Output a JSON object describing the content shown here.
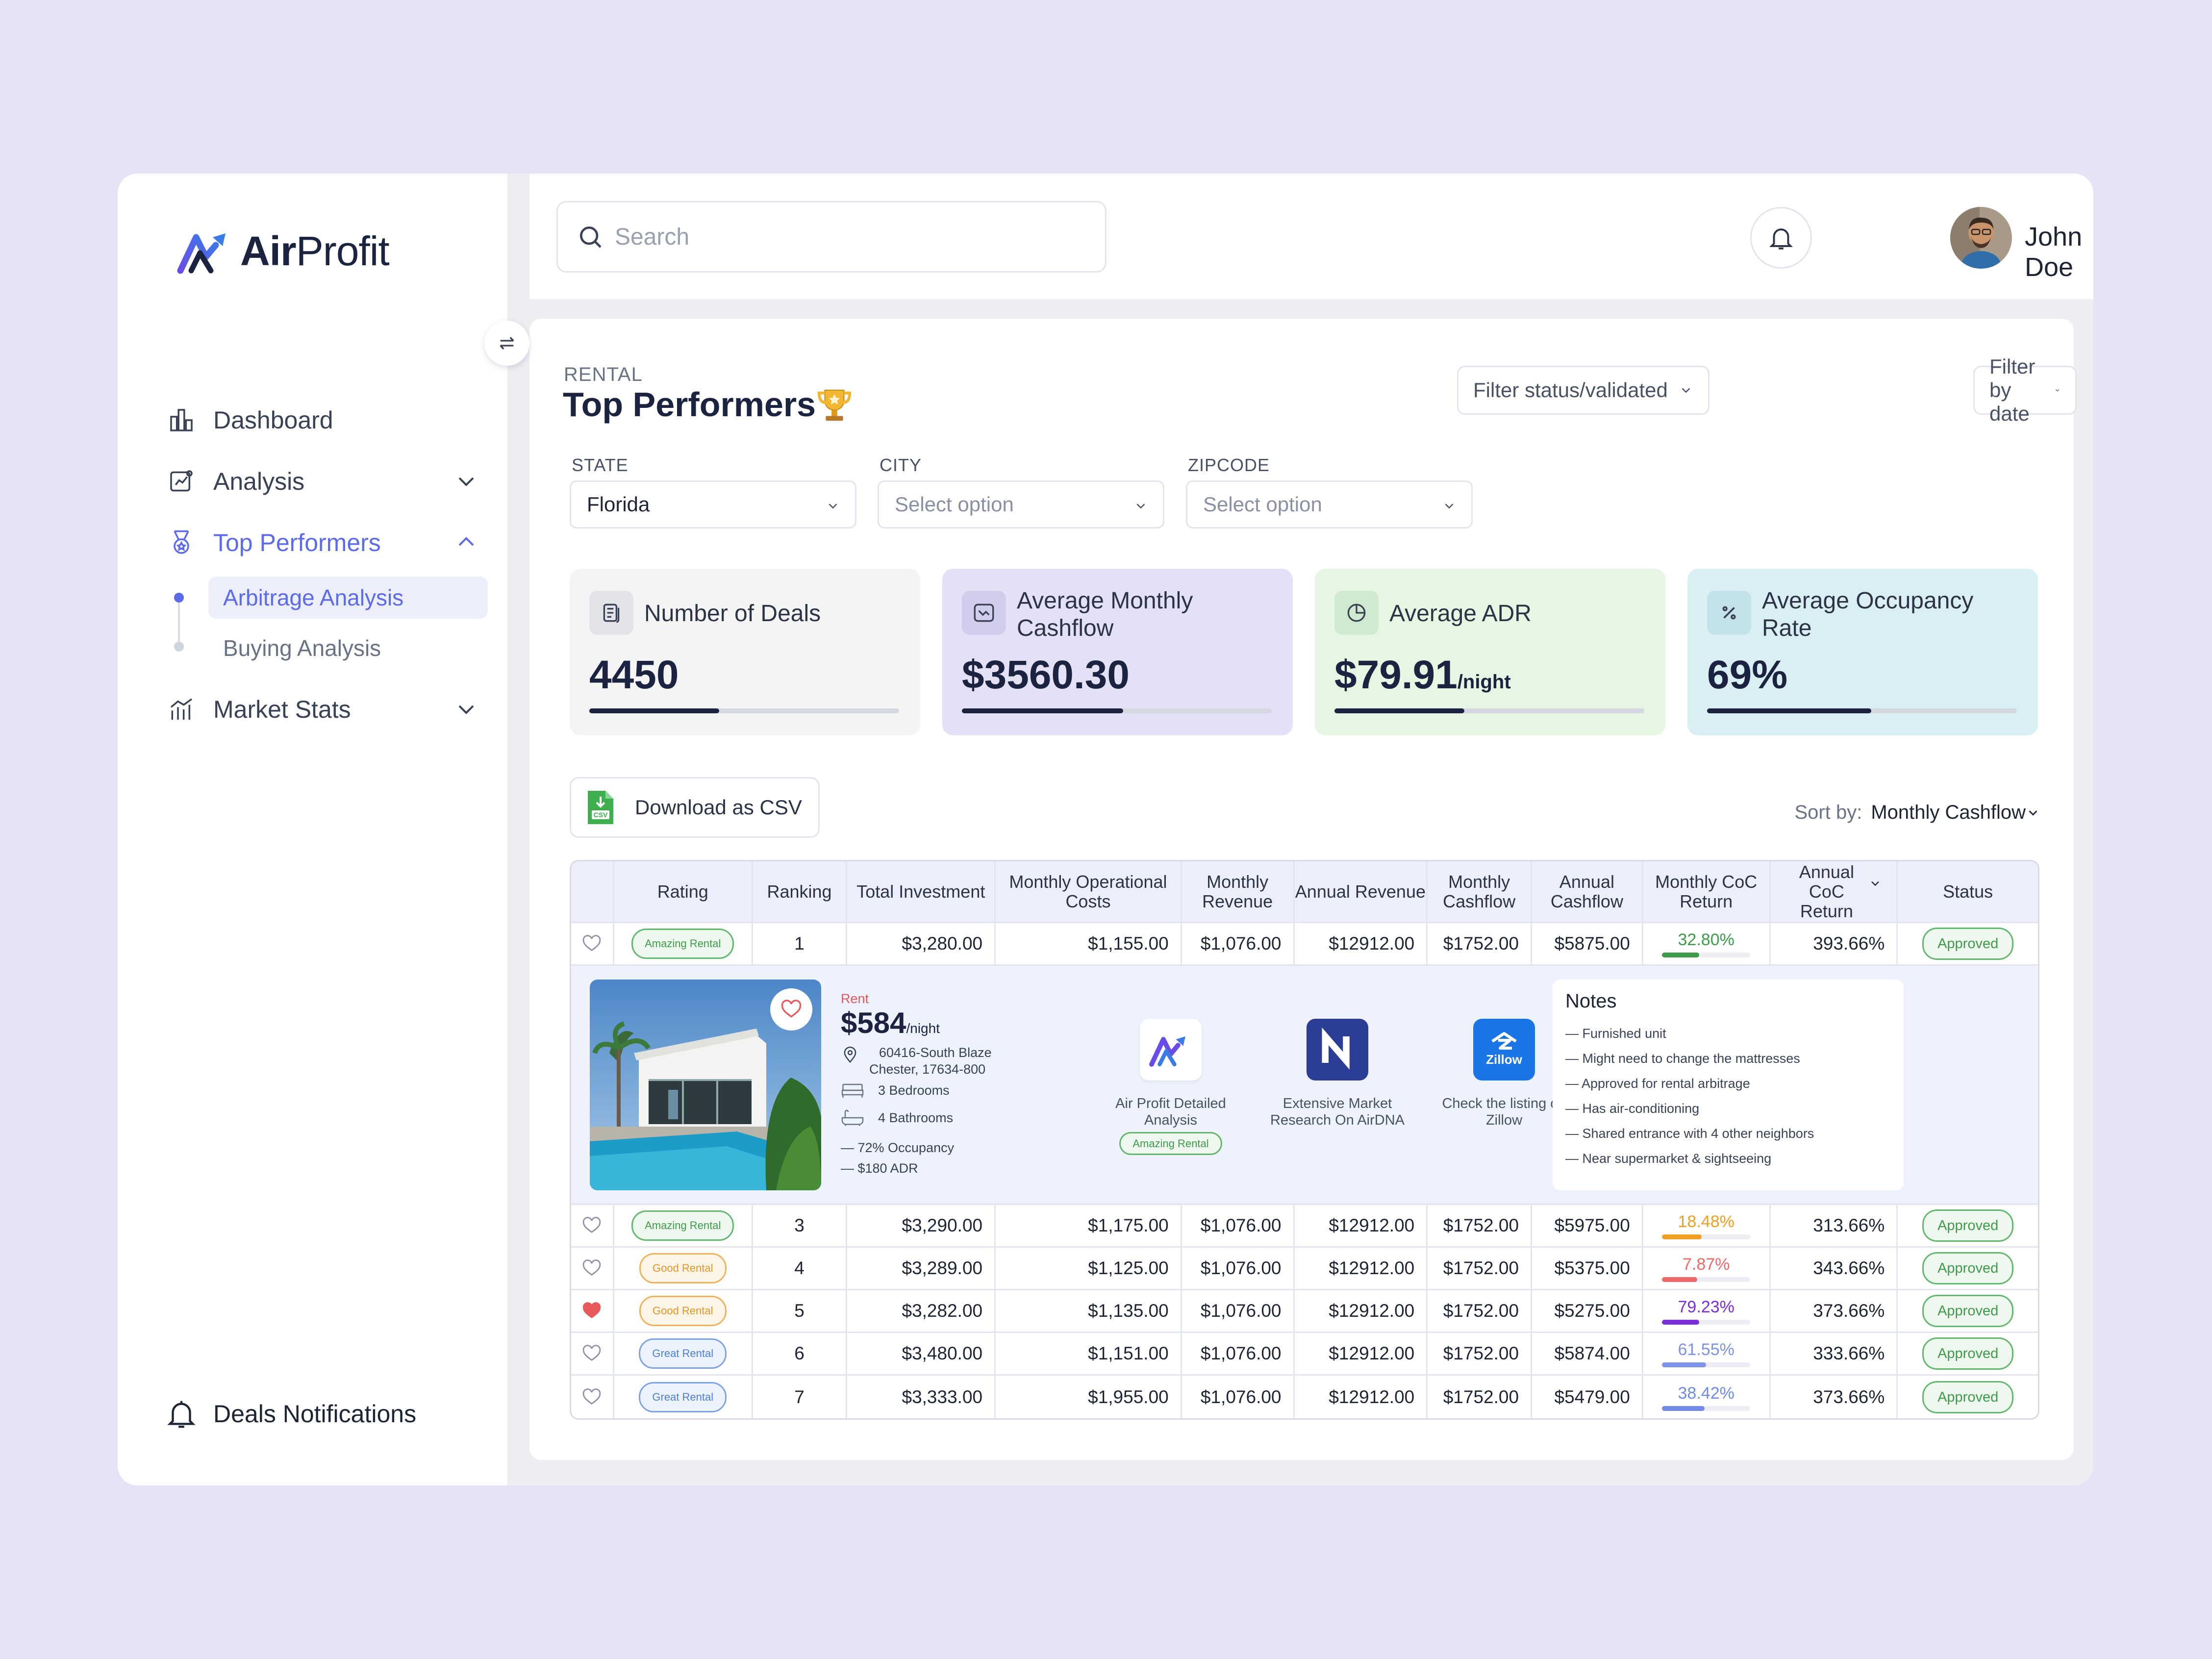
{
  "brand": {
    "name_bold": "Air",
    "name_rest": "Profit"
  },
  "sidebar": {
    "items": [
      {
        "label": "Dashboard"
      },
      {
        "label": "Analysis"
      },
      {
        "label": "Top Performers"
      },
      {
        "label": "Market Stats"
      }
    ],
    "sub_items": [
      {
        "label": "Arbitrage Analysis"
      },
      {
        "label": "Buying Analysis"
      }
    ],
    "footer": {
      "label": "Deals Notifications"
    }
  },
  "header": {
    "search_placeholder": "Search",
    "user_name": "John Doe"
  },
  "page": {
    "kicker": "RENTAL",
    "title": "Top Performers",
    "filter_status": "Filter status/validated",
    "filter_date": "Filter by date",
    "state_label": "STATE",
    "state_value": "Florida",
    "city_label": "CITY",
    "city_value": "Select option",
    "zip_label": "ZIPCODE",
    "zip_value": "Select option"
  },
  "cards": [
    {
      "title": "Number of Deals",
      "value": "4450",
      "unit": "",
      "progress": 0.42,
      "color": "#f4f4f5"
    },
    {
      "title": "Average Monthly Cashflow",
      "value": "$3560.30",
      "unit": "",
      "progress": 0.52,
      "color": "#e4e1f6"
    },
    {
      "title": "Average ADR",
      "value": "$79.91",
      "unit": "/night",
      "progress": 0.42,
      "color": "#e6f6e3"
    },
    {
      "title": "Average Occupancy Rate",
      "value": "69%",
      "unit": "",
      "progress": 0.53,
      "color": "#d9eff4"
    }
  ],
  "toolbar": {
    "csv_label": "Download as CSV",
    "sort_label": "Sort by:",
    "sort_value": "Monthly Cashflow"
  },
  "table": {
    "headers": [
      "Rating",
      "Ranking",
      "Total Investment",
      "Monthly Operational Costs",
      "Monthly Revenue",
      "Annual Revenue",
      "Monthly Cashflow",
      "Annual Cashflow",
      "Monthly CoC Return",
      "Annual CoC Return",
      "Status"
    ],
    "rows": [
      {
        "fav": false,
        "rating": "Amazing Rental",
        "rtype": "amazing",
        "rank": "1",
        "inv": "$3,280.00",
        "ops": "$1,155.00",
        "mrev": "$1,076.00",
        "arev": "$12912.00",
        "mcf": "$1752.00",
        "acf": "$5875.00",
        "coc": "32.80%",
        "coc_val": 0.42,
        "coc_color": "#3d9b4a",
        "acoc": "393.66%",
        "status": "Approved"
      },
      {
        "fav": false,
        "rating": "Amazing Rental",
        "rtype": "amazing",
        "rank": "3",
        "inv": "$3,290.00",
        "ops": "$1,175.00",
        "mrev": "$1,076.00",
        "arev": "$12912.00",
        "mcf": "$1752.00",
        "acf": "$5975.00",
        "coc": "18.48%",
        "coc_val": 0.45,
        "coc_color": "#f0a020",
        "acoc": "313.66%",
        "status": "Approved"
      },
      {
        "fav": false,
        "rating": "Good Rental",
        "rtype": "good",
        "rank": "4",
        "inv": "$3,289.00",
        "ops": "$1,125.00",
        "mrev": "$1,076.00",
        "arev": "$12912.00",
        "mcf": "$1752.00",
        "acf": "$5375.00",
        "coc": "7.87%",
        "coc_val": 0.4,
        "coc_color": "#ee6a6a",
        "acoc": "343.66%",
        "status": "Approved"
      },
      {
        "fav": true,
        "rating": "Good Rental",
        "rtype": "good",
        "rank": "5",
        "inv": "$3,282.00",
        "ops": "$1,135.00",
        "mrev": "$1,076.00",
        "arev": "$12912.00",
        "mcf": "$1752.00",
        "acf": "$5275.00",
        "coc": "79.23%",
        "coc_val": 0.42,
        "coc_color": "#7a2fd6",
        "acoc": "373.66%",
        "status": "Approved"
      },
      {
        "fav": false,
        "rating": "Great Rental",
        "rtype": "great",
        "rank": "6",
        "inv": "$3,480.00",
        "ops": "$1,151.00",
        "mrev": "$1,076.00",
        "arev": "$12912.00",
        "mcf": "$1752.00",
        "acf": "$5874.00",
        "coc": "61.55%",
        "coc_val": 0.5,
        "coc_color": "#7e93e8",
        "acoc": "333.66%",
        "status": "Approved"
      },
      {
        "fav": false,
        "rating": "Great Rental",
        "rtype": "great",
        "rank": "7",
        "inv": "$3,333.00",
        "ops": "$1,955.00",
        "mrev": "$1,076.00",
        "arev": "$12912.00",
        "mcf": "$1752.00",
        "acf": "$5479.00",
        "coc": "38.42%",
        "coc_val": 0.48,
        "coc_color": "#6f8be6",
        "acoc": "373.66%",
        "status": "Approved"
      }
    ]
  },
  "detail": {
    "rent_label": "Rent",
    "price": "$584",
    "price_unit": "/night",
    "address_line1": "60416-South Blaze",
    "address_line2": "Chester, 17634-800",
    "bedrooms_count": "3",
    "bedrooms_label": "Bedrooms",
    "bathrooms_count": "4",
    "bathrooms_label": "Bathrooms",
    "occupancy": "— 72% Occupancy",
    "adr": "— $180 ADR",
    "tools": [
      {
        "label": "Air Profit Detailed Analysis",
        "badge": "Amazing Rental"
      },
      {
        "label": "Extensive Market Research On  AirDNA"
      },
      {
        "label": "Check the listing on Zillow",
        "tile_text": "Zillow"
      }
    ],
    "notes_title": "Notes",
    "notes": [
      "— Furnished unit",
      "— Might need to change the mattresses",
      "— Approved for rental arbitrage",
      "— Has air-conditioning",
      "— Shared entrance with 4 other neighbors",
      "— Near supermarket & sightseeing"
    ]
  }
}
